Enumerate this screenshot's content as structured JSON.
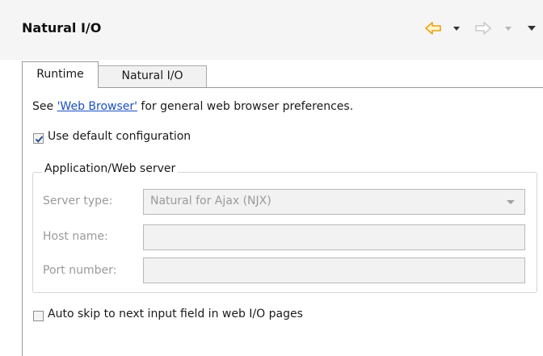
{
  "view": {
    "title": "Natural I/O"
  },
  "nav": {
    "back_icon": "back-arrow-icon",
    "back_menu_icon": "dropdown-arrow-icon",
    "forward_icon": "forward-arrow-icon",
    "forward_menu_icon": "dropdown-arrow-icon",
    "view_menu_icon": "view-menu-icon",
    "back_color": "#e8a21c",
    "forward_color": "#c9c9c9"
  },
  "tabs": [
    {
      "label": "Runtime",
      "active": true
    },
    {
      "label": "Natural I/O",
      "active": false
    }
  ],
  "runtime": {
    "see_prefix": "See ",
    "browser_link": "'Web Browser'",
    "see_suffix": " for general web browser preferences.",
    "use_default_label": "Use default configuration",
    "use_default_checked": true,
    "group_title": "Application/Web server",
    "server_type_label": "Server type:",
    "server_type_value": "Natural for Ajax (NJX)",
    "host_name_label": "Host name:",
    "host_name_value": "",
    "port_number_label": "Port number:",
    "port_number_value": "",
    "auto_skip_label": "Auto skip to next input field in web I/O pages",
    "auto_skip_checked": false
  }
}
